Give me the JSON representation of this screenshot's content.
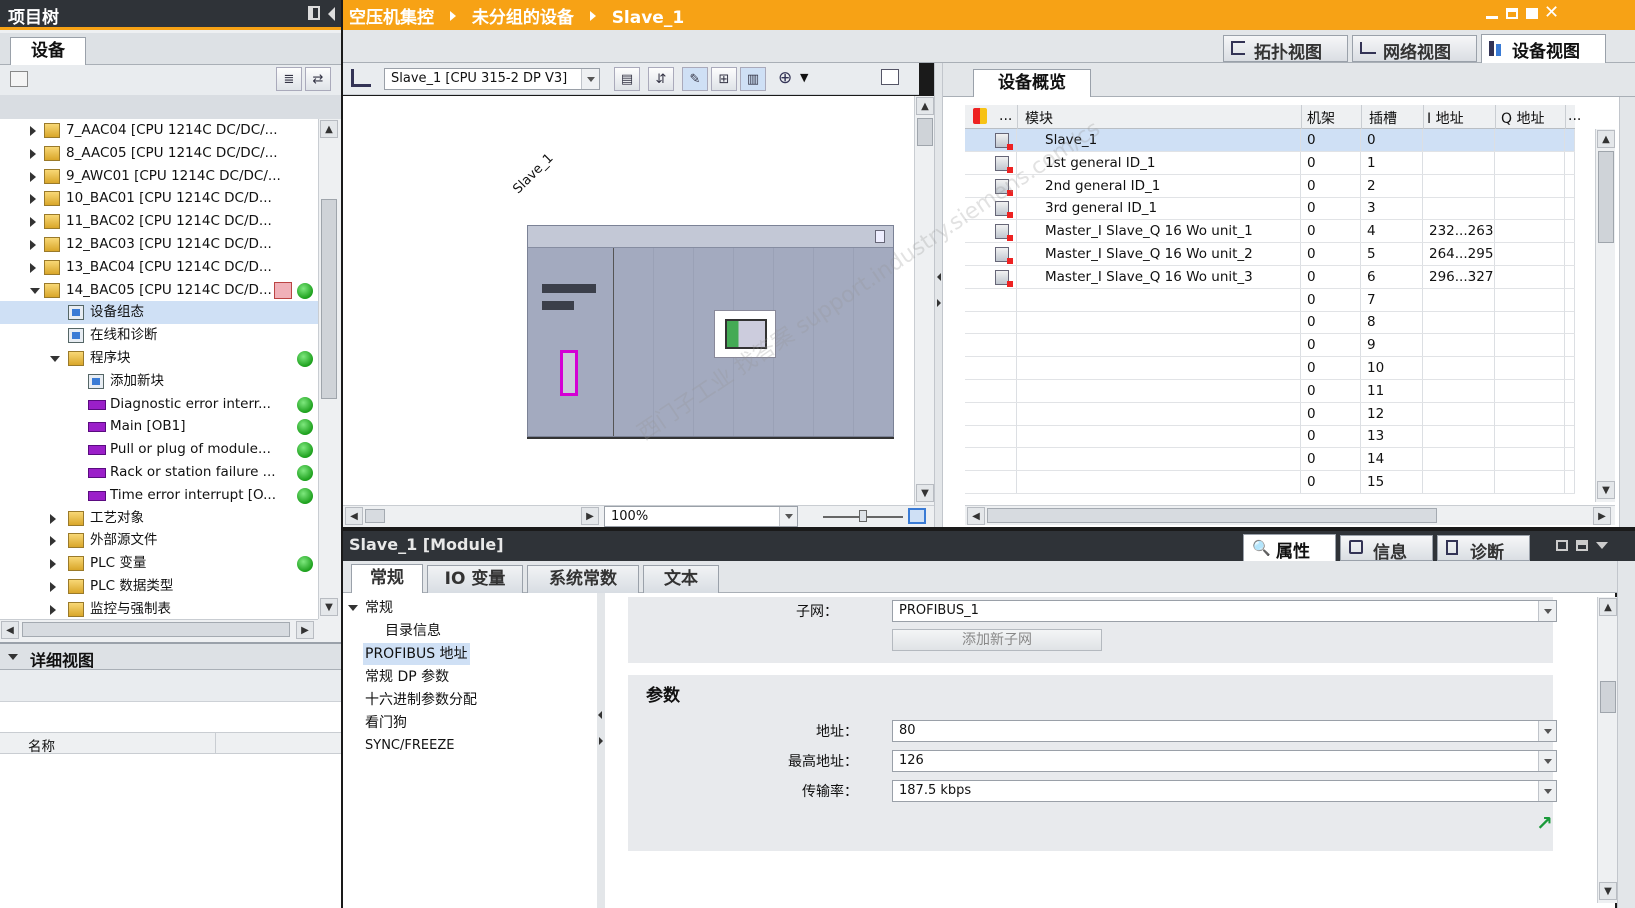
{
  "left_panel": {
    "title": "项目树",
    "tab": "设备",
    "tree": [
      {
        "label": "7_AAC04 [CPU 1214C DC/DC/...",
        "level": 1,
        "expand": "collapsed",
        "icon": "cpu",
        "status": ""
      },
      {
        "label": "8_AAC05 [CPU 1214C DC/DC/...",
        "level": 1,
        "expand": "collapsed",
        "icon": "cpu",
        "status": ""
      },
      {
        "label": "9_AWC01 [CPU 1214C DC/DC/...",
        "level": 1,
        "expand": "collapsed",
        "icon": "cpu",
        "status": ""
      },
      {
        "label": "10_BAC01 [CPU 1214C DC/D...",
        "level": 1,
        "expand": "collapsed",
        "icon": "cpu",
        "status": ""
      },
      {
        "label": "11_BAC02 [CPU 1214C DC/D...",
        "level": 1,
        "expand": "collapsed",
        "icon": "cpu",
        "status": ""
      },
      {
        "label": "12_BAC03 [CPU 1214C DC/D...",
        "level": 1,
        "expand": "collapsed",
        "icon": "cpu",
        "status": ""
      },
      {
        "label": "13_BAC04 [CPU 1214C DC/D...",
        "level": 1,
        "expand": "collapsed",
        "icon": "cpu",
        "status": ""
      },
      {
        "label": "14_BAC05 [CPU 1214C DC/D...",
        "level": 1,
        "expand": "expanded",
        "icon": "cpu",
        "status": "ok"
      },
      {
        "label": "设备组态",
        "level": 2,
        "expand": "none",
        "icon": "devcfg",
        "status": ""
      },
      {
        "label": "在线和诊断",
        "level": 2,
        "expand": "none",
        "icon": "diag",
        "status": ""
      },
      {
        "label": "程序块",
        "level": 2,
        "expand": "expanded",
        "icon": "folder",
        "status": "ok"
      },
      {
        "label": "添加新块",
        "level": 3,
        "expand": "none",
        "icon": "addblock",
        "status": ""
      },
      {
        "label": "Diagnostic error interr...",
        "level": 3,
        "expand": "none",
        "icon": "block",
        "status": "ok"
      },
      {
        "label": "Main [OB1]",
        "level": 3,
        "expand": "none",
        "icon": "block",
        "status": "ok"
      },
      {
        "label": "Pull or plug of module...",
        "level": 3,
        "expand": "none",
        "icon": "block",
        "status": "ok"
      },
      {
        "label": "Rack or station failure ...",
        "level": 3,
        "expand": "none",
        "icon": "block",
        "status": "ok"
      },
      {
        "label": "Time error interrupt [O...",
        "level": 3,
        "expand": "none",
        "icon": "block",
        "status": "ok"
      },
      {
        "label": "工艺对象",
        "level": 2,
        "expand": "collapsed",
        "icon": "folder",
        "status": ""
      },
      {
        "label": "外部源文件",
        "level": 2,
        "expand": "collapsed",
        "icon": "folder",
        "status": ""
      },
      {
        "label": "PLC 变量",
        "level": 2,
        "expand": "collapsed",
        "icon": "folder",
        "status": "ok"
      },
      {
        "label": "PLC 数据类型",
        "level": 2,
        "expand": "collapsed",
        "icon": "folder",
        "status": ""
      },
      {
        "label": "监控与强制表",
        "level": 2,
        "expand": "collapsed",
        "icon": "folder",
        "status": ""
      }
    ],
    "detail_title": "详细视图",
    "detail_col": "名称"
  },
  "header": {
    "breadcrumb": [
      "空压机集控",
      "未分组的设备",
      "Slave_1"
    ]
  },
  "view_tabs": {
    "topology": "拓扑视图",
    "network": "网络视图",
    "device": "设备视图"
  },
  "device_view": {
    "device_select": "Slave_1 [CPU 315-2 DP V3]",
    "station_label": "Slave_1",
    "zoom": "100%"
  },
  "overview": {
    "tab": "设备概览",
    "columns": {
      "dots": "...",
      "module": "模块",
      "rack": "机架",
      "slot": "插槽",
      "iaddr": "I 地址",
      "qaddr": "Q 地址",
      "more": "..."
    },
    "rows": [
      {
        "module": "Slave_1",
        "rack": "0",
        "slot": "0",
        "iaddr": "",
        "icon": true
      },
      {
        "module": "1st general ID_1",
        "rack": "0",
        "slot": "1",
        "iaddr": "",
        "icon": true
      },
      {
        "module": "2nd general ID_1",
        "rack": "0",
        "slot": "2",
        "iaddr": "",
        "icon": true
      },
      {
        "module": "3rd general ID_1",
        "rack": "0",
        "slot": "3",
        "iaddr": "",
        "icon": true
      },
      {
        "module": "Master_I Slave_Q 16 Wo unit_1",
        "rack": "0",
        "slot": "4",
        "iaddr": "232...263",
        "icon": true
      },
      {
        "module": "Master_I Slave_Q 16 Wo unit_2",
        "rack": "0",
        "slot": "5",
        "iaddr": "264...295",
        "icon": true
      },
      {
        "module": "Master_I Slave_Q 16 Wo unit_3",
        "rack": "0",
        "slot": "6",
        "iaddr": "296...327",
        "icon": true
      },
      {
        "module": "",
        "rack": "0",
        "slot": "7",
        "iaddr": "",
        "icon": false
      },
      {
        "module": "",
        "rack": "0",
        "slot": "8",
        "iaddr": "",
        "icon": false
      },
      {
        "module": "",
        "rack": "0",
        "slot": "9",
        "iaddr": "",
        "icon": false
      },
      {
        "module": "",
        "rack": "0",
        "slot": "10",
        "iaddr": "",
        "icon": false
      },
      {
        "module": "",
        "rack": "0",
        "slot": "11",
        "iaddr": "",
        "icon": false
      },
      {
        "module": "",
        "rack": "0",
        "slot": "12",
        "iaddr": "",
        "icon": false
      },
      {
        "module": "",
        "rack": "0",
        "slot": "13",
        "iaddr": "",
        "icon": false
      },
      {
        "module": "",
        "rack": "0",
        "slot": "14",
        "iaddr": "",
        "icon": false
      },
      {
        "module": "",
        "rack": "0",
        "slot": "15",
        "iaddr": "",
        "icon": false
      }
    ]
  },
  "properties": {
    "title": "Slave_1 [Module]",
    "inspector_tabs": {
      "props": "属性",
      "info": "信息",
      "diag": "诊断"
    },
    "tabs": [
      "常规",
      "IO 变量",
      "系统常数",
      "文本"
    ],
    "nav": [
      "常规",
      "目录信息",
      "PROFIBUS 地址",
      "常规 DP 参数",
      "十六进制参数分配",
      "看门狗",
      "SYNC/FREEZE"
    ],
    "subnet_label": "子网：",
    "subnet_value": "PROFIBUS_1",
    "add_subnet": "添加新子网",
    "params_title": "参数",
    "address_label": "地址：",
    "address_value": "80",
    "highest_label": "最高地址：",
    "highest_value": "126",
    "baud_label": "传输率：",
    "baud_value": "187.5 kbps"
  },
  "watermark": "西门子工业 找答案 support.industry.siemens.com/cs",
  "colors": {
    "accent": "#f7a215",
    "title_bar": "#2f3338",
    "selection": "#cfe0f5",
    "ok_green": "#1da01d"
  }
}
